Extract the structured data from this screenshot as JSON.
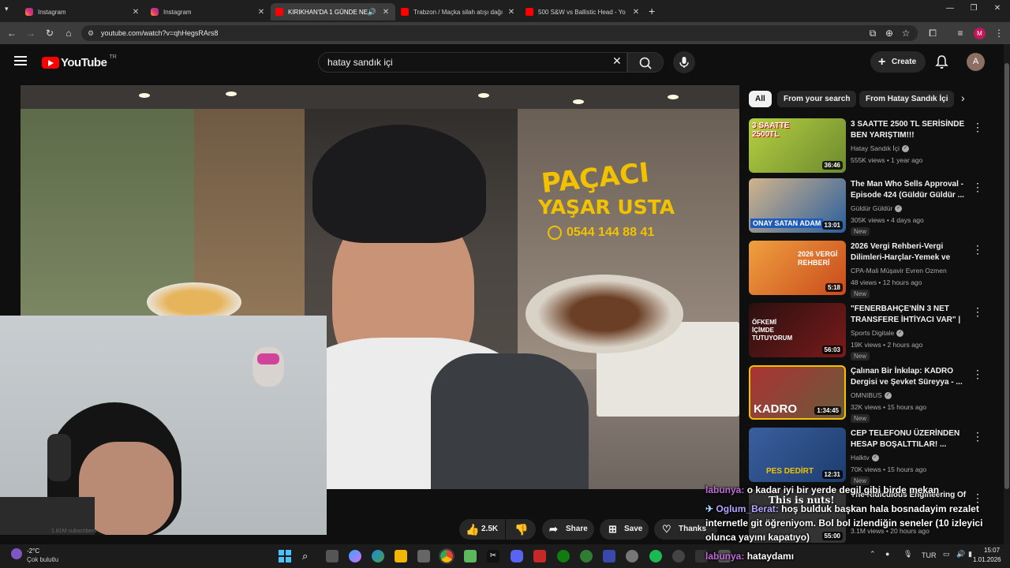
{
  "browser": {
    "tabs": [
      {
        "title": "Instagram",
        "kind": "ig"
      },
      {
        "title": "Instagram",
        "kind": "ig"
      },
      {
        "title": "KIRIKHAN'DA 1 GÜNDE NE",
        "kind": "yt"
      },
      {
        "title": "Trabzon / Maçka silah atışı dağı",
        "kind": "yt"
      },
      {
        "title": "500 S&W vs Ballistic Head - Yo",
        "kind": "yt"
      }
    ],
    "url": "youtube.com/watch?v=qhHegsRArs8",
    "profile_initial": "M"
  },
  "youtube": {
    "logo_text": "YouTube",
    "country_code": "TR",
    "search_value": "hatay sandık içi",
    "create_label": "Create",
    "avatar_initial": "A"
  },
  "video_overlay": {
    "sign_text_1": "PAÇACI",
    "sign_text_2": "YAŞAR USTA",
    "sign_phone": "0544 144 88 41",
    "channel_subs": "1.81M subscribers"
  },
  "chips": [
    "All",
    "From your search",
    "From Hatay Sandık İçi"
  ],
  "recommendations": [
    {
      "title": "3 SAATTE 2500 TL SERİSİNDE BEN YARIŞTIM!!!",
      "channel": "Hatay Sandık İçi",
      "verified": true,
      "meta": "555K views • 1 year ago",
      "duration": "36:46",
      "badge": "",
      "thumb_text": "3 SAATTE 2500TL",
      "thumb_color": "#6d8a2f"
    },
    {
      "title": "The Man Who Sells Approval - Episode 424 (Güldür Güldür ...",
      "channel": "Güldür Güldür",
      "verified": true,
      "meta": "305K views • 4 days ago",
      "duration": "13:01",
      "badge": "New",
      "thumb_text": "ONAY SATAN ADAM",
      "thumb_color": "#2a5f9e"
    },
    {
      "title": "2026 Vergi Rehberi-Vergi Dilimleri-Harçlar-Yemek ve Yol...",
      "channel": "CPA-Mali Müşavir Evren Ozmen",
      "verified": false,
      "meta": "48 views • 12 hours ago",
      "duration": "5:18",
      "badge": "New",
      "thumb_text": "2026 VERGİ REHBERİ",
      "thumb_color": "#c94a1c"
    },
    {
      "title": "\"FENERBAHÇE'NİN 3 NET TRANSFERE İHTİYACI VAR\" | ...",
      "channel": "Sports Digitale",
      "verified": true,
      "meta": "19K views • 2 hours ago",
      "duration": "56:03",
      "badge": "New",
      "thumb_text": "ÖFKEMİ İÇİMDE TUTUYORUM",
      "thumb_color": "#7a1a1a"
    },
    {
      "title": "Çalınan Bir İnkılap: KADRO Dergisi ve Şevket Süreyya - ...",
      "channel": "OMNIBUS",
      "verified": true,
      "meta": "32K views • 15 hours ago",
      "duration": "1:34:45",
      "badge": "New",
      "thumb_text": "KADRO",
      "thumb_color": "#6b5a3a"
    },
    {
      "title": "CEP TELEFONU ÜZERİNDEN HESAP BOŞALTTILAR! ...",
      "channel": "Halktv",
      "verified": true,
      "meta": "70K views • 15 hours ago",
      "duration": "12:31",
      "badge": "New",
      "thumb_text": "PES DEDİRT",
      "thumb_color": "#1d3d6e"
    },
    {
      "title": "The Ridiculous Engineering Of ...",
      "channel": "",
      "verified": false,
      "meta": "3.1M views • 20 hours ago",
      "duration": "55:00",
      "badge": "",
      "thumb_text": "This is nuts!",
      "thumb_color": "#333333"
    }
  ],
  "actions": {
    "likes": "2.5K",
    "share": "Share",
    "save": "Save",
    "thanks": "Thanks"
  },
  "chat": [
    {
      "user": "labunya:",
      "text": "o kadar iyi bir yerde degil gibi birde mekan"
    },
    {
      "user": "Oglum_Berat:",
      "text": "hoş bulduk başkan hala bosnadayim rezalet"
    },
    {
      "user": "",
      "text": "internetle git öğreniyom. Bol bol izlendiğin seneler (10 izleyici"
    },
    {
      "user": "",
      "text": "olunca yayını kapatıyo)"
    },
    {
      "user": "labunya:",
      "text": "hataydamı"
    }
  ],
  "overlay_text": "This is nuts!",
  "taskbar": {
    "weather_temp": "-2°C",
    "weather_desc": "Çok bulutlu",
    "lang": "TUR",
    "time": "15:07",
    "date": "1.01.2026"
  }
}
